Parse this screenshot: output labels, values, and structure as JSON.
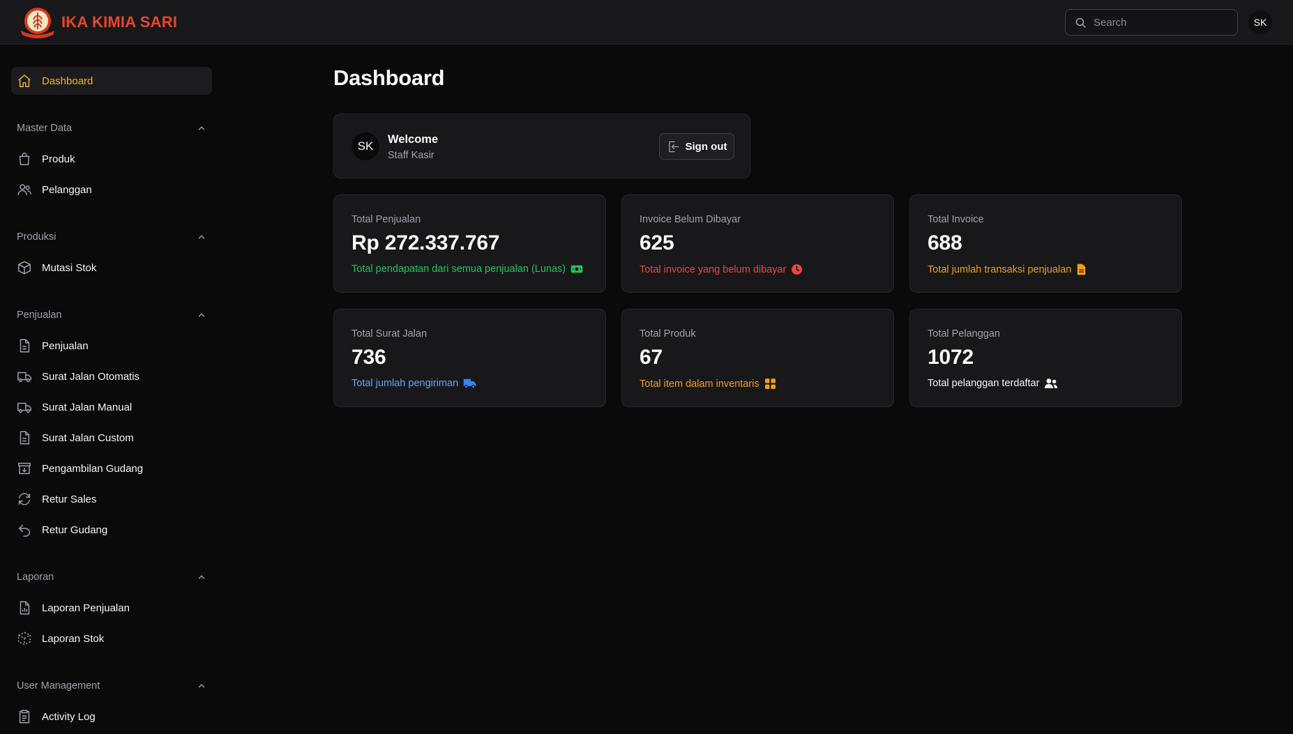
{
  "app": {
    "brand_name": "IKA KIMIA SARI",
    "brand_color": "#e8462a",
    "logo_icon": "wheat-emblem-icon"
  },
  "header": {
    "search_placeholder": "Search",
    "avatar_initials": "SK"
  },
  "sidebar": {
    "dashboard": {
      "label": "Dashboard",
      "icon": "home-icon",
      "active": true
    },
    "sections": [
      {
        "title": "Master Data",
        "items": [
          {
            "label": "Produk",
            "icon": "shopping-bag-icon"
          },
          {
            "label": "Pelanggan",
            "icon": "users-icon"
          }
        ]
      },
      {
        "title": "Produksi",
        "items": [
          {
            "label": "Mutasi Stok",
            "icon": "cube-icon"
          }
        ]
      },
      {
        "title": "Penjualan",
        "items": [
          {
            "label": "Penjualan",
            "icon": "document-icon"
          },
          {
            "label": "Surat Jalan Otomatis",
            "icon": "truck-icon"
          },
          {
            "label": "Surat Jalan Manual",
            "icon": "truck-icon"
          },
          {
            "label": "Surat Jalan Custom",
            "icon": "document-icon"
          },
          {
            "label": "Pengambilan Gudang",
            "icon": "archive-box-icon"
          },
          {
            "label": "Retur Sales",
            "icon": "refresh-icon"
          },
          {
            "label": "Retur Gudang",
            "icon": "undo-arrow-icon"
          }
        ]
      },
      {
        "title": "Laporan",
        "items": [
          {
            "label": "Laporan Penjualan",
            "icon": "chart-document-icon"
          },
          {
            "label": "Laporan Stok",
            "icon": "dashed-cube-icon"
          }
        ]
      },
      {
        "title": "User Management",
        "items": [
          {
            "label": "Activity Log",
            "icon": "clipboard-icon"
          }
        ]
      }
    ]
  },
  "main": {
    "page_title": "Dashboard",
    "welcome": {
      "avatar_initials": "SK",
      "title": "Welcome",
      "subtitle": "Staff Kasir",
      "signout_label": "Sign out"
    },
    "stats": [
      {
        "label": "Total Penjualan",
        "value": "Rp 272.337.767",
        "desc": "Total pendapatan dari semua penjualan (Lunas)",
        "color": "#22c55e",
        "icon": "banknote-icon"
      },
      {
        "label": "Invoice Belum Dibayar",
        "value": "625",
        "desc": "Total invoice yang belum dibayar",
        "color": "#ef4444",
        "icon": "clock-icon"
      },
      {
        "label": "Total Invoice",
        "value": "688",
        "desc": "Total jumlah transaksi penjualan",
        "color": "#f59e0b",
        "icon": "document-filled-icon"
      },
      {
        "label": "Total Surat Jalan",
        "value": "736",
        "desc": "Total jumlah pengiriman",
        "color": "#3b82f6",
        "icon": "truck-filled-icon"
      },
      {
        "label": "Total Produk",
        "value": "67",
        "desc": "Total item dalam inventaris",
        "color": "#f59e0b",
        "icon": "squares-icon"
      },
      {
        "label": "Total Pelanggan",
        "value": "1072",
        "desc": "Total pelanggan terdaftar",
        "color": "#f4f4f5",
        "icon": "users-filled-icon"
      }
    ]
  },
  "colors": {
    "background": "#0a0a0b",
    "surface": "#18181b",
    "border": "#27272a",
    "accent": "#f0b429"
  }
}
